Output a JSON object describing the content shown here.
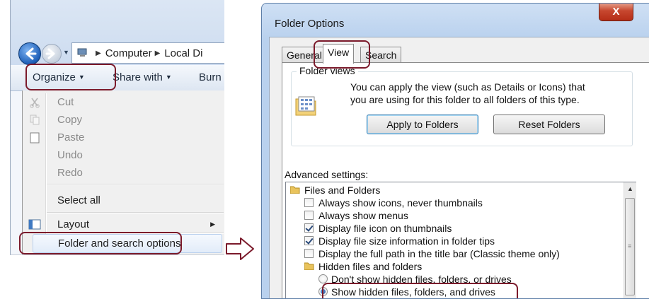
{
  "explorer": {
    "breadcrumb": [
      "Computer",
      "Local Di"
    ],
    "toolbar": {
      "organize_label": "Organize",
      "share_label": "Share with",
      "burn_label": "Burn"
    },
    "menu": {
      "cut": "Cut",
      "copy": "Copy",
      "paste": "Paste",
      "undo": "Undo",
      "redo": "Redo",
      "select_all": "Select all",
      "layout": "Layout",
      "folder_options": "Folder and search options"
    }
  },
  "dialog": {
    "title": "Folder Options",
    "close_glyph": "X",
    "tabs": {
      "general": "General",
      "view": "View",
      "search": "Search"
    },
    "folder_views": {
      "legend": "Folder views",
      "description": "You can apply the view (such as Details or Icons) that you are using for this folder to all folders of this type.",
      "apply_button": "Apply to Folders",
      "reset_button": "Reset Folders"
    },
    "advanced": {
      "label": "Advanced settings:",
      "files_and_folders": "Files and Folders",
      "always_icons": "Always show icons, never thumbnails",
      "always_menus": "Always show menus",
      "file_icon_thumbs": "Display file icon on thumbnails",
      "file_size_tips": "Display file size information in folder tips",
      "full_path": "Display the full path in the title bar (Classic theme only)",
      "hidden_files_folder": "Hidden files and folders",
      "dont_show_hidden": "Don't show hidden files, folders, or drives",
      "show_hidden": "Show hidden files, folders, and drives"
    }
  },
  "colors": {
    "highlight": "#7b1a2b",
    "close_button": "#c7472f",
    "accent_blue": "#1d5fb8"
  }
}
